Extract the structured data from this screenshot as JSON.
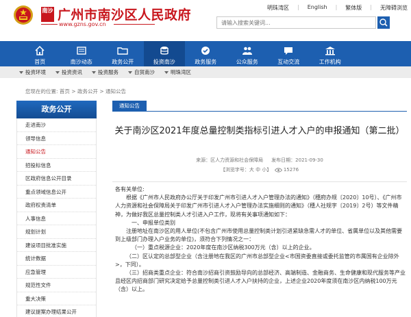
{
  "header": {
    "logo_mark": "南沙",
    "site_title": "广州市南沙区人民政府",
    "site_url": "www.gzns.gov.cn",
    "top_links": [
      "明珠湾区",
      "English",
      "繁体版",
      "无障碍浏览"
    ],
    "search_placeholder": "请输入搜索关键词..."
  },
  "nav": {
    "items": [
      {
        "label": "首页",
        "icon": "home-icon"
      },
      {
        "label": "南沙动态",
        "icon": "news-icon"
      },
      {
        "label": "政务公开",
        "icon": "folder-icon"
      },
      {
        "label": "投资南沙",
        "icon": "coins-icon"
      },
      {
        "label": "政务服务",
        "icon": "service-icon"
      },
      {
        "label": "公众服务",
        "icon": "people-icon"
      },
      {
        "label": "互动交流",
        "icon": "chat-icon"
      },
      {
        "label": "工作机构",
        "icon": "building-icon"
      }
    ],
    "active_index": 3
  },
  "subnav": {
    "items": [
      "投资环境",
      "投资资讯",
      "投资服务",
      "自贸南沙",
      "明珠湾区"
    ]
  },
  "breadcrumb": "您现在的位置: 首页 > 政务公开 > 通知公告",
  "sidebar": {
    "title": "政务公开",
    "items": [
      "走进南沙",
      "领导信息",
      "通知公告",
      "招投标信息",
      "区政府信息公开目录",
      "重点领域信息公开",
      "政府权责清单",
      "人事信息",
      "规划计划",
      "建设项目批准实施",
      "统计数据",
      "应急管理",
      "规范性文件",
      "重大决策",
      "建议提案办理结果公开"
    ],
    "active_index": 2
  },
  "main": {
    "tab_label": "通知公告",
    "title": "关于南沙区2021年度总量控制类指标引进人才入户的申报通知（第二批）",
    "source": "来源：区人力资源和社会保障局",
    "date": "发布日期：2021-09-30",
    "font_size_label": "【浏览字号：大 中 小】",
    "views": "15276",
    "body": [
      "各有关单位:",
      "根据《广州市人民政府办公厅关于印发广州市引进人才入户管理办法的通知》（穗府办规〔2020〕10号）、《广州市人力资源和社会保障局关于印发广州市引进人才入户管理办法实施细则的通知》（穗人社规字〔2019〕2号）等文件精神，为做好我区总量控制类人才引进入户工作，现将有关事项通知如下：",
      "一、申报单位类别",
      "注册地址在南沙区的用人单位(不包含广州市使用总量控制类计划引进紧缺急需人才的单位、省属单位以及其他需要到上级部门办理入户业务的单位)，须符合下列情况之一：",
      "（一）重点税源企业：2020年度在南沙区纳税300万元（含）以上的企业。",
      "（二）区认定的总部型企业（含注册地在我区的广州市总部型企业<市国资委直接或委托监管的市属国有企业除外>，下同）。",
      "（三）招商类重点企业：符合南沙招商引资鼓励导向的总部经济、高端制造、金融商务、生命健康和现代服务等产业且经区内招商部门研究决定给予总量控制类引进人才入户扶持的企业，上述企业2020年度须在南沙区内纳税100万元（含）以上。"
    ]
  }
}
